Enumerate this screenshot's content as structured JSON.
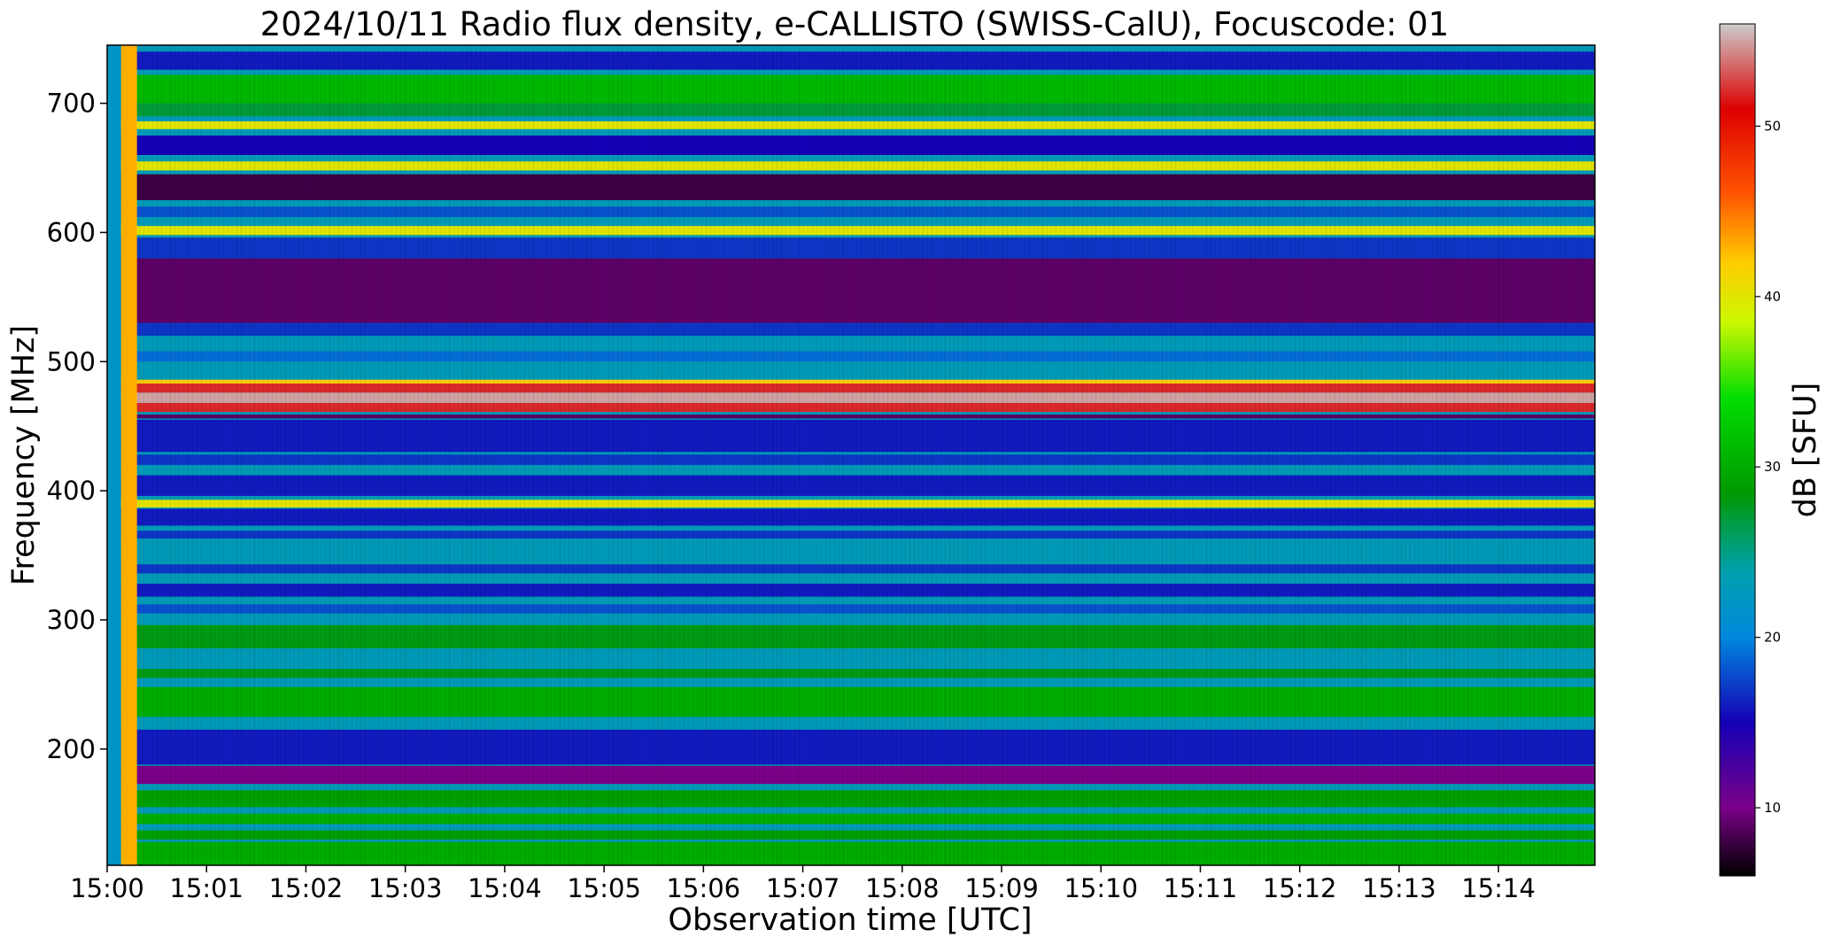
{
  "chart_data": {
    "type": "heatmap",
    "title": "2024/10/11  Radio flux density, e-CALLISTO (SWISS-CalU), Focuscode: 01",
    "xlabel": "Observation time [UTC]",
    "ylabel": "Frequency [MHz]",
    "colorbar_label": "dB [SFU]",
    "x_ticks": [
      "15:00",
      "15:01",
      "15:02",
      "15:03",
      "15:04",
      "15:05",
      "15:06",
      "15:07",
      "15:08",
      "15:09",
      "15:10",
      "15:11",
      "15:12",
      "15:13",
      "15:14"
    ],
    "xlim_minutes": [
      0,
      14.97
    ],
    "y_ticks": [
      200,
      300,
      400,
      500,
      600,
      700
    ],
    "ylim": [
      110,
      745
    ],
    "colorbar_ticks": [
      10,
      20,
      30,
      40,
      50
    ],
    "clim": [
      6,
      56
    ],
    "colormap": "nipy_spectral",
    "grid": false,
    "background_level_db": 23,
    "bands": [
      {
        "f_low": 110,
        "f_high": 128,
        "db": 30
      },
      {
        "f_low": 130,
        "f_high": 137,
        "db": 29
      },
      {
        "f_low": 142,
        "f_high": 150,
        "db": 30
      },
      {
        "f_low": 155,
        "f_high": 168,
        "db": 29
      },
      {
        "f_low": 173,
        "f_high": 187,
        "db": 10
      },
      {
        "f_low": 188,
        "f_high": 215,
        "db": 16
      },
      {
        "f_low": 225,
        "f_high": 248,
        "db": 30
      },
      {
        "f_low": 255,
        "f_high": 262,
        "db": 28
      },
      {
        "f_low": 278,
        "f_high": 296,
        "db": 28
      },
      {
        "f_low": 305,
        "f_high": 312,
        "db": 18
      },
      {
        "f_low": 318,
        "f_high": 328,
        "db": 16
      },
      {
        "f_low": 336,
        "f_high": 343,
        "db": 17
      },
      {
        "f_low": 363,
        "f_high": 369,
        "db": 17
      },
      {
        "f_low": 373,
        "f_high": 386,
        "db": 16
      },
      {
        "f_low": 387,
        "f_high": 393,
        "db": 40
      },
      {
        "f_low": 396,
        "f_high": 412,
        "db": 16
      },
      {
        "f_low": 420,
        "f_high": 428,
        "db": 17
      },
      {
        "f_low": 430,
        "f_high": 455,
        "db": 16
      },
      {
        "f_low": 456,
        "f_high": 459,
        "db": 9
      },
      {
        "f_low": 461,
        "f_high": 468,
        "db": 52
      },
      {
        "f_low": 468,
        "f_high": 476,
        "db": 55
      },
      {
        "f_low": 476,
        "f_high": 483,
        "db": 52
      },
      {
        "f_low": 483,
        "f_high": 486,
        "db": 42
      },
      {
        "f_low": 500,
        "f_high": 508,
        "db": 19
      },
      {
        "f_low": 520,
        "f_high": 530,
        "db": 17
      },
      {
        "f_low": 530,
        "f_high": 580,
        "db": 9
      },
      {
        "f_low": 580,
        "f_high": 596,
        "db": 17
      },
      {
        "f_low": 598,
        "f_high": 605,
        "db": 40
      },
      {
        "f_low": 612,
        "f_high": 620,
        "db": 18
      },
      {
        "f_low": 625,
        "f_high": 645,
        "db": 8
      },
      {
        "f_low": 648,
        "f_high": 655,
        "db": 40
      },
      {
        "f_low": 660,
        "f_high": 675,
        "db": 15
      },
      {
        "f_low": 680,
        "f_high": 686,
        "db": 40
      },
      {
        "f_low": 690,
        "f_high": 700,
        "db": 27
      },
      {
        "f_low": 700,
        "f_high": 722,
        "db": 31
      },
      {
        "f_low": 726,
        "f_high": 740,
        "db": 16
      }
    ],
    "calibration_columns": [
      {
        "t_start_min": 0.0,
        "t_end_min": 0.14,
        "db": 22
      },
      {
        "t_start_min": 0.14,
        "t_end_min": 0.3,
        "db": 43
      }
    ]
  }
}
